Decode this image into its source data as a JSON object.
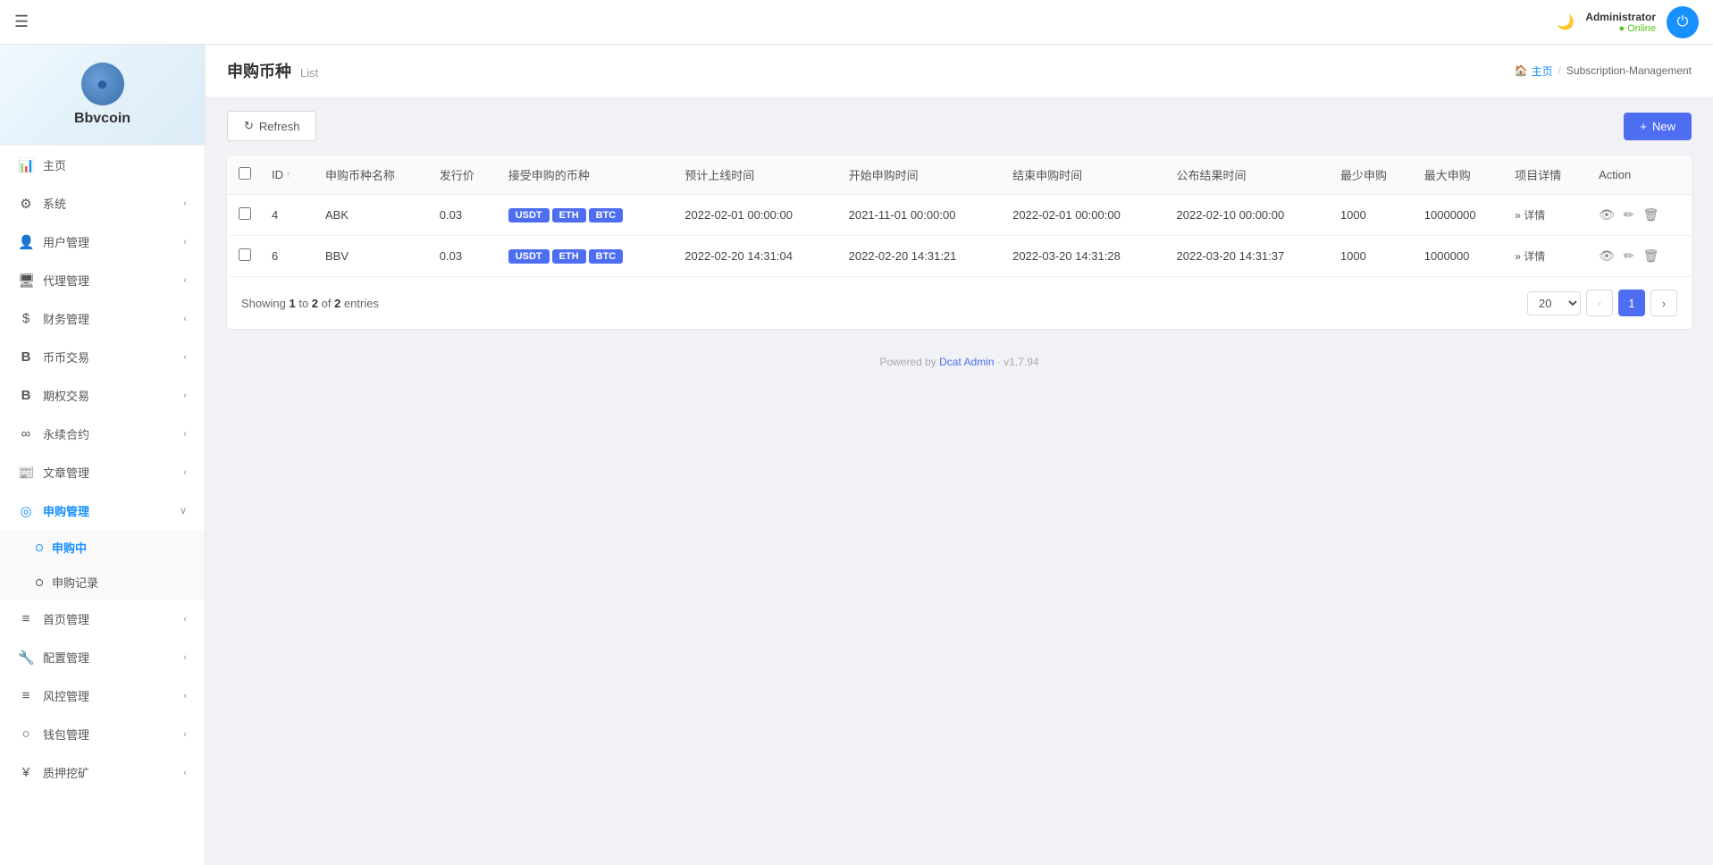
{
  "app": {
    "logo_text": "Bbvcoin",
    "hamburger_icon": "☰"
  },
  "topbar": {
    "moon_icon": "🌙",
    "user": {
      "name": "Administrator",
      "status": "Online"
    },
    "avatar_icon": "⏻"
  },
  "sidebar": {
    "items": [
      {
        "id": "home",
        "icon": "📊",
        "label": "主页",
        "has_arrow": false
      },
      {
        "id": "system",
        "icon": "⚙",
        "label": "系统",
        "has_arrow": true
      },
      {
        "id": "user-mgmt",
        "icon": "👤",
        "label": "用户管理",
        "has_arrow": true
      },
      {
        "id": "agent-mgmt",
        "icon": "🖥",
        "label": "代理管理",
        "has_arrow": true
      },
      {
        "id": "finance-mgmt",
        "icon": "$",
        "label": "财务管理",
        "has_arrow": true
      },
      {
        "id": "coin-trade",
        "icon": "B",
        "label": "币币交易",
        "has_arrow": true
      },
      {
        "id": "options-trade",
        "icon": "B",
        "label": "期权交易",
        "has_arrow": true
      },
      {
        "id": "perpetual",
        "icon": "∞",
        "label": "永续合约",
        "has_arrow": true
      },
      {
        "id": "article-mgmt",
        "icon": "📰",
        "label": "文章管理",
        "has_arrow": true
      },
      {
        "id": "subscription-mgmt",
        "icon": "◎",
        "label": "申购管理",
        "has_arrow": true,
        "active": true,
        "expanded": true
      },
      {
        "id": "homepage-mgmt",
        "icon": "≡",
        "label": "首页管理",
        "has_arrow": true
      },
      {
        "id": "config-mgmt",
        "icon": "🔧",
        "label": "配置管理",
        "has_arrow": true
      },
      {
        "id": "risk-mgmt",
        "icon": "≡",
        "label": "风控管理",
        "has_arrow": true
      },
      {
        "id": "wallet-mgmt",
        "icon": "○",
        "label": "钱包管理",
        "has_arrow": true
      },
      {
        "id": "mining-mgmt",
        "icon": "¥",
        "label": "质押挖矿",
        "has_arrow": true
      }
    ],
    "sub_items": [
      {
        "id": "subscription-active",
        "label": "申购中",
        "active": true
      },
      {
        "id": "subscription-records",
        "label": "申购记录",
        "active": false
      }
    ]
  },
  "page": {
    "title": "申购币种",
    "subtitle": "List",
    "breadcrumb": {
      "home": "主页",
      "home_icon": "🏠",
      "current": "Subscription-Management"
    }
  },
  "toolbar": {
    "refresh_icon": "↻",
    "refresh_label": "Refresh",
    "new_icon": "+",
    "new_label": "New"
  },
  "table": {
    "columns": [
      "ID",
      "申购币种名称",
      "发行价",
      "接受申购的币种",
      "预计上线时间",
      "开始申购时间",
      "结束申购时间",
      "公布结果时间",
      "最少申购",
      "最大申购",
      "项目详情",
      "Action"
    ],
    "rows": [
      {
        "id": "4",
        "name": "ABK",
        "price": "0.03",
        "currencies": [
          "USDT",
          "ETH",
          "BTC"
        ],
        "listing_time": "2022-02-01 00:00:00",
        "start_time": "2021-11-01 00:00:00",
        "end_time": "2022-02-01 00:00:00",
        "result_time": "2022-02-10 00:00:00",
        "min_sub": "1000",
        "max_sub": "10000000",
        "detail_label": "» 详情"
      },
      {
        "id": "6",
        "name": "BBV",
        "price": "0.03",
        "currencies": [
          "USDT",
          "ETH",
          "BTC"
        ],
        "listing_time": "2022-02-20 14:31:04",
        "start_time": "2022-02-20 14:31:21",
        "end_time": "2022-03-20 14:31:28",
        "result_time": "2022-03-20 14:31:37",
        "min_sub": "1000",
        "max_sub": "1000000",
        "detail_label": "» 详情"
      }
    ],
    "footer": {
      "showing_prefix": "Showing",
      "showing_from": "1",
      "showing_to": "2",
      "total": "2",
      "showing_suffix": "entries"
    }
  },
  "pagination": {
    "page_size": "20",
    "current_page": 1,
    "prev_icon": "‹",
    "next_icon": "›"
  },
  "footer": {
    "powered_by": "Powered by",
    "link_text": "Dcat Admin",
    "version": "· v1.7.94"
  }
}
